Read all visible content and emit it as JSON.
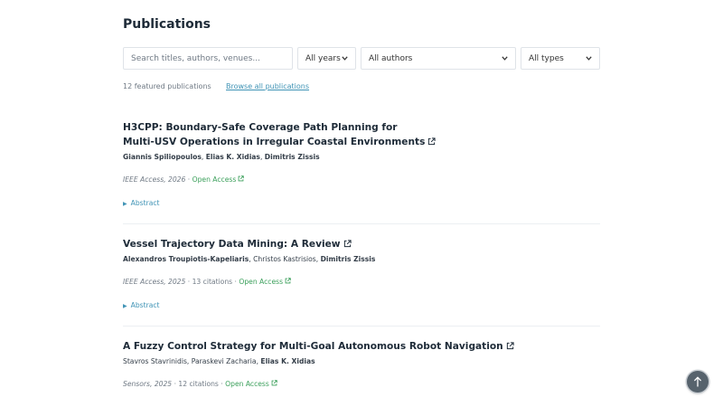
{
  "header": {
    "title": "Publications"
  },
  "filters": {
    "search_placeholder": "Search titles, authors, venues...",
    "years_label": "All years",
    "authors_label": "All authors",
    "types_label": "All types"
  },
  "summary": {
    "count_text": "12 featured publications",
    "browse_label": "Browse all publications"
  },
  "publications": [
    {
      "title_line1": "H3CPP: Boundary-Safe Coverage Path Planning for",
      "title_line2": "Multi-USV Operations in Irregular Coastal Environments",
      "authors": [
        {
          "name": "Giannis Spiliopoulos",
          "bold": true,
          "sep": ", "
        },
        {
          "name": "Elias K. Xidias",
          "bold": true,
          "sep": ", "
        },
        {
          "name": "Dimitris Zissis",
          "bold": true,
          "sep": ""
        }
      ],
      "venue": "IEEE Access, 2026",
      "citations": "",
      "open_access": "Open Access",
      "abstract_label": "Abstract"
    },
    {
      "title": "Vessel Trajectory Data Mining: A Review",
      "authors": [
        {
          "name": "Alexandros Troupiotis-Kapeliaris",
          "bold": true,
          "sep": ", "
        },
        {
          "name": "Christos Kastrisios",
          "bold": false,
          "sep": ", "
        },
        {
          "name": "Dimitris Zissis",
          "bold": true,
          "sep": ""
        }
      ],
      "venue": "IEEE Access, 2025",
      "citations": "13 citations",
      "open_access": "Open Access",
      "abstract_label": "Abstract"
    },
    {
      "title": "A Fuzzy Control Strategy for Multi-Goal Autonomous Robot Navigation",
      "authors": [
        {
          "name": "Stavros Stavrinidis",
          "bold": false,
          "sep": ", "
        },
        {
          "name": "Paraskevi Zacharia",
          "bold": false,
          "sep": ", "
        },
        {
          "name": "Elias K. Xidias",
          "bold": true,
          "sep": ""
        }
      ],
      "venue": "Sensors, 2025",
      "citations": "12 citations",
      "open_access": "Open Access"
    }
  ],
  "icons": {
    "external": "external-link-icon",
    "scroll_top": "arrow-up-icon",
    "chevron": "chevron-down-icon",
    "disclosure": "triangle-right-icon"
  },
  "colors": {
    "link": "#3f93b5",
    "open_access": "#3a9f5a",
    "title": "#1e2b38",
    "muted": "#707a85"
  }
}
